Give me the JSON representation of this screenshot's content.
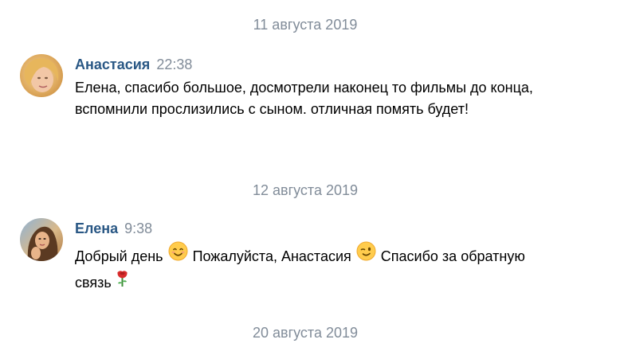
{
  "dates": {
    "first": "11 августа 2019",
    "second": "12 августа 2019",
    "third": "20 августа 2019"
  },
  "messages": [
    {
      "author": "Анастасия",
      "time": "22:38",
      "text": "Елена, спасибо большое, досмотрели наконец то фильмы до конца, вспомнили прослизились с сыном. отличная помять будет!",
      "avatar_icon": "user-avatar-photo"
    },
    {
      "author": "Елена",
      "time": "9:38",
      "text_parts": [
        "Добрый день ",
        " Пожалуйста, Анастасия ",
        " Спасибо за обратную связь"
      ],
      "emojis": [
        "smiling-face-emoji",
        "winking-face-emoji",
        "rose-emoji"
      ],
      "avatar_icon": "user-avatar-photo"
    }
  ],
  "colors": {
    "author": "#2a5885",
    "meta": "#818c99",
    "text": "#000000"
  }
}
